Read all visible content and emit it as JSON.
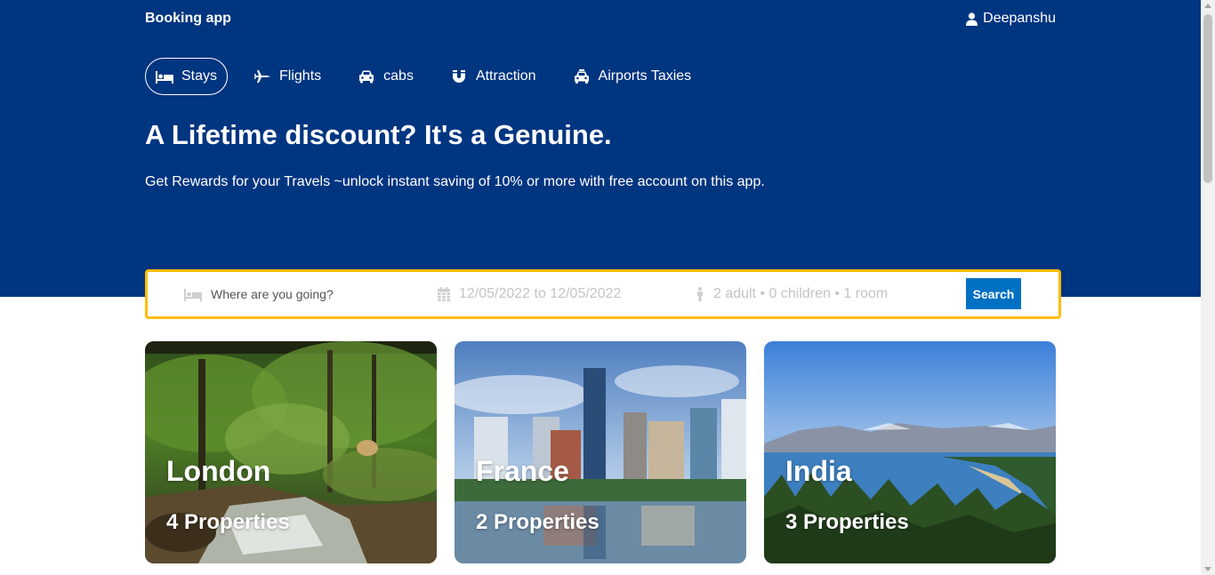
{
  "header": {
    "brand": "Booking app",
    "user_name": "Deepanshu"
  },
  "nav": {
    "items": [
      {
        "label": "Stays",
        "icon": "bed-icon",
        "active": true
      },
      {
        "label": "Flights",
        "icon": "plane-icon",
        "active": false
      },
      {
        "label": "cabs",
        "icon": "car-icon",
        "active": false
      },
      {
        "label": "Attraction",
        "icon": "magnet-icon",
        "active": false
      },
      {
        "label": "Airports Taxies",
        "icon": "taxi-icon",
        "active": false
      }
    ]
  },
  "hero": {
    "title": "A Lifetime discount? It's a Genuine.",
    "subtitle": "Get Rewards for your Travels ~unlock instant saving of 10% or more with free account on this app."
  },
  "search": {
    "destination_placeholder": "Where are you going?",
    "destination_value": "",
    "date_text": "12/05/2022 to 12/05/2022",
    "guests_text": "2 adult • 0 children • 1 room",
    "button_label": "Search"
  },
  "featured": [
    {
      "city": "London",
      "properties": "4 Properties"
    },
    {
      "city": "France",
      "properties": "2 Properties"
    },
    {
      "city": "India",
      "properties": "3 Properties"
    }
  ],
  "colors": {
    "hero_bg": "#003580",
    "search_border": "#febb02",
    "search_button": "#0071c2"
  }
}
